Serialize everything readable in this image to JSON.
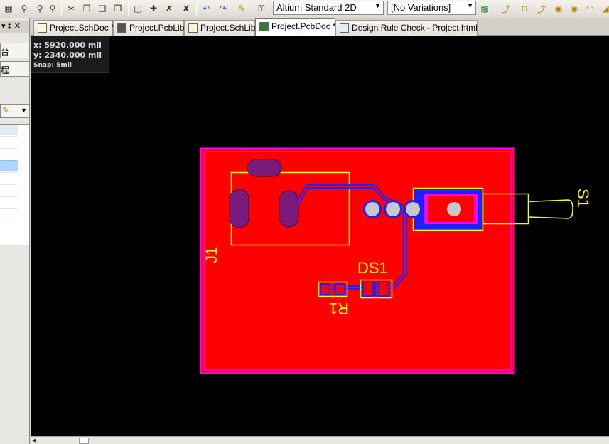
{
  "toolbar": {
    "view_mode": "Altium Standard 2D",
    "variations": "[No Variations]"
  },
  "left_panel": {
    "pin_glyph": "▾ ‡ ✕",
    "text_1": "台",
    "text_2": "程"
  },
  "tabs": [
    {
      "label": "Project.SchDoc *"
    },
    {
      "label": "Project.PcbLib"
    },
    {
      "label": "Project.SchLib"
    },
    {
      "label": "Project.PcbDoc *",
      "active": true
    },
    {
      "label": "Design Rule Check - Project.html"
    }
  ],
  "coords": {
    "x": "x:  5920.000  mil",
    "y": "y:  2340.000  mil",
    "snap": "Snap: 5mil"
  },
  "pcb": {
    "designators": {
      "j1": "J1",
      "s1": "S1",
      "ds1": "DS1",
      "r1": "R1"
    },
    "colors": {
      "board_copper": "#ff0000",
      "outline": "#ff00ff",
      "silkscreen": "#ffff00",
      "bottom_track": "#2020ff",
      "pad_dark": "#7a1a7a",
      "pad_light": "#c8c8c8"
    }
  }
}
